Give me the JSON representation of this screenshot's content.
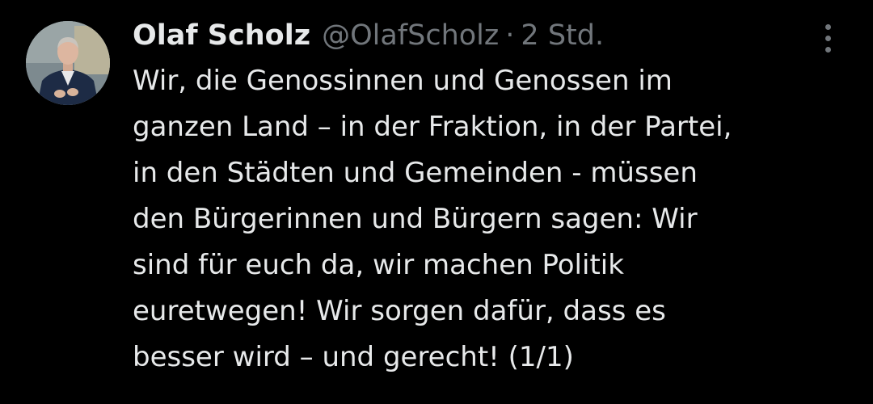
{
  "tweet": {
    "author_name": "Olaf Scholz",
    "handle": "@OlafScholz",
    "separator": "·",
    "time": "2 Std.",
    "avatar_icon": "profile-photo",
    "more_icon": "more-vertical-icon",
    "lines": [
      "Wir, die Genossinnen und Genossen im",
      "ganzen Land – in der Fraktion, in der Partei,",
      "in den Städten und Gemeinden - müssen",
      "den Bürgerinnen und Bürgern sagen: Wir",
      "sind für euch da, wir machen Politik",
      "euretwegen! Wir sorgen dafür, dass es",
      "besser wird – und gerecht! (1/1)"
    ]
  },
  "colors": {
    "background": "#000000",
    "text_primary": "#e7e9ea",
    "text_secondary": "#71767b"
  }
}
